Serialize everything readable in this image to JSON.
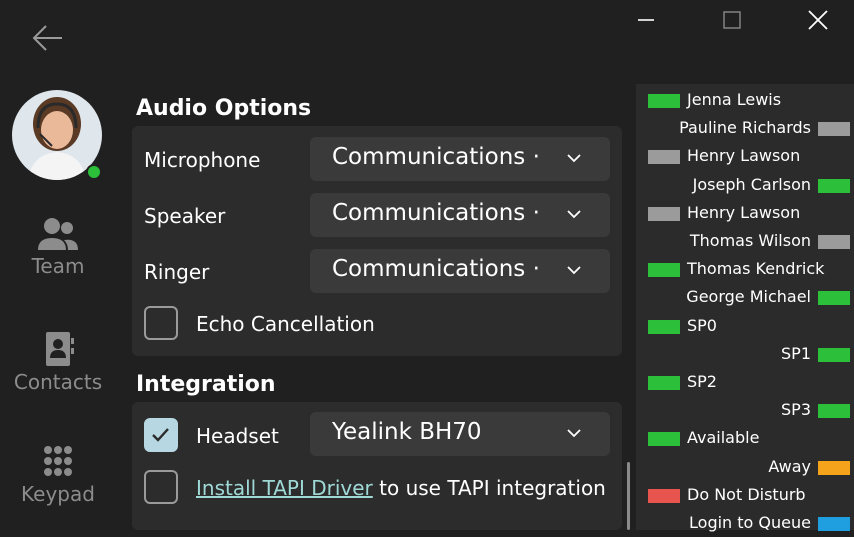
{
  "colors": {
    "available": "#2bbf3a",
    "offline": "#9b9b9b",
    "away": "#f5a31a",
    "dnd": "#e8544e",
    "queue": "#1f9ee0"
  },
  "icons": {
    "back": "arrow-left-icon",
    "minimize": "minimize-icon",
    "maximize": "maximize-icon",
    "close": "close-icon",
    "team": "team-icon",
    "contacts": "contacts-icon",
    "keypad": "keypad-icon",
    "dropdown": "chevron-down-icon",
    "check": "check-icon"
  },
  "sidebar": {
    "team_label": "Team",
    "contacts_label": "Contacts",
    "keypad_label": "Keypad"
  },
  "audio": {
    "title": "Audio Options",
    "microphone_label": "Microphone",
    "microphone_value": "Communications ·",
    "speaker_label": "Speaker",
    "speaker_value": "Communications ·",
    "ringer_label": "Ringer",
    "ringer_value": "Communications ·",
    "echo_label": "Echo Cancellation",
    "echo_checked": false
  },
  "integration": {
    "title": "Integration",
    "headset_label": "Headset",
    "headset_checked": true,
    "headset_value": "Yealink BH70",
    "tapi_link": "Install TAPI Driver",
    "tapi_suffix": " to use TAPI integration",
    "tapi_checked": false
  },
  "team": [
    {
      "name": "Jenna Lewis",
      "status": "available",
      "side": "left"
    },
    {
      "name": "Pauline Richards",
      "status": "offline",
      "side": "right"
    },
    {
      "name": "Henry Lawson",
      "status": "offline",
      "side": "left"
    },
    {
      "name": "Joseph Carlson",
      "status": "available",
      "side": "right"
    },
    {
      "name": "Henry Lawson",
      "status": "offline",
      "side": "left"
    },
    {
      "name": "Thomas Wilson",
      "status": "offline",
      "side": "right"
    },
    {
      "name": "Thomas Kendrick",
      "status": "available",
      "side": "left"
    },
    {
      "name": "George Michael",
      "status": "available",
      "side": "right"
    },
    {
      "name": "SP0",
      "status": "available",
      "side": "left"
    },
    {
      "name": "SP1",
      "status": "available",
      "side": "right"
    },
    {
      "name": "SP2",
      "status": "available",
      "side": "left"
    },
    {
      "name": "SP3",
      "status": "available",
      "side": "right"
    },
    {
      "name": "Available",
      "status": "available",
      "side": "left"
    },
    {
      "name": "Away",
      "status": "away",
      "side": "right"
    },
    {
      "name": "Do Not Disturb",
      "status": "dnd",
      "side": "left"
    },
    {
      "name": "Login to Queue",
      "status": "queue",
      "side": "right"
    }
  ]
}
